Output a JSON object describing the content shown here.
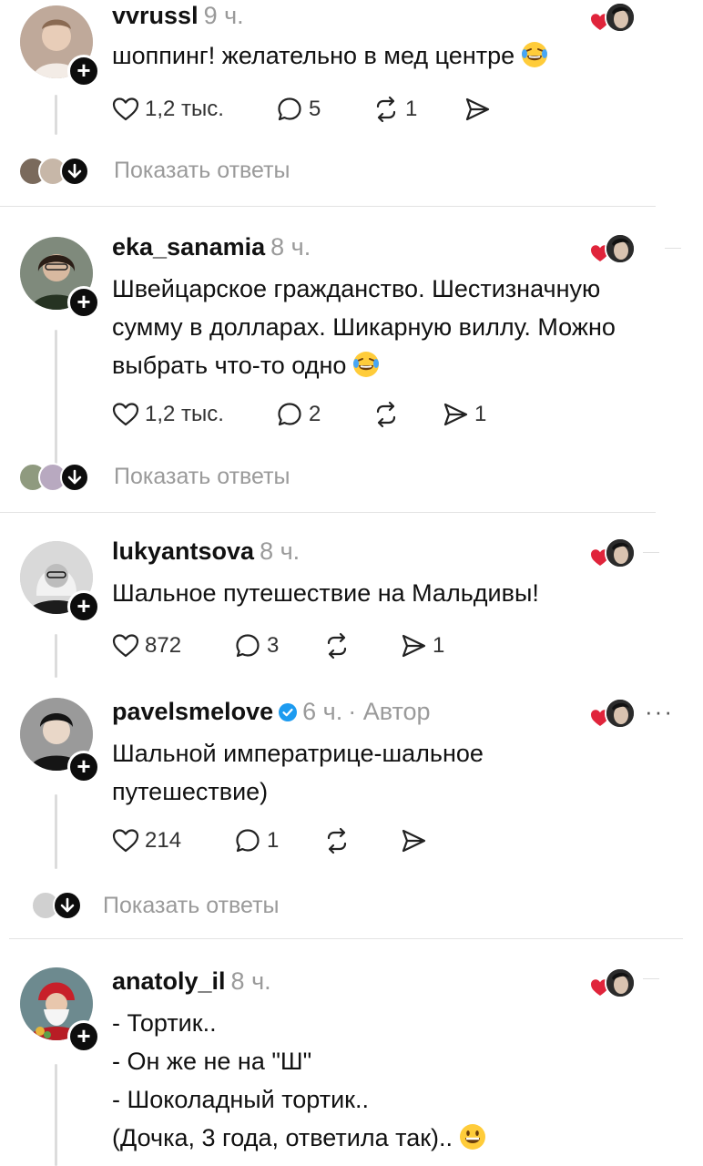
{
  "posts": [
    {
      "username": "vvrussl",
      "time": "9 ч.",
      "lines": [
        "шоппинг! желательно в мед центре"
      ],
      "emoji": "laughing-tears",
      "likes": "1,2 тыс.",
      "comments": "5",
      "reposts": "1",
      "shares": "",
      "show_replies": "Показать ответы"
    },
    {
      "username": "eka_sanamia",
      "time": "8 ч.",
      "lines": [
        "Швейцарское гражданство. Шестизначную",
        "сумму в долларах. Шикарную виллу. Можно",
        "выбрать что-то одно"
      ],
      "emoji": "laughing-tears",
      "likes": "1,2 тыс.",
      "comments": "2",
      "reposts": "",
      "shares": "1",
      "show_replies": "Показать ответы"
    },
    {
      "username": "lukyantsova",
      "time": "8 ч.",
      "lines": [
        "Шальное путешествие на Мальдивы!"
      ],
      "likes": "872",
      "comments": "3",
      "reposts": "",
      "shares": "1"
    },
    {
      "username": "pavelsmelove",
      "time": "6 ч.",
      "author_label": "· Автор",
      "verified": true,
      "lines": [
        "Шальной императрице-шальное",
        "путешествие)"
      ],
      "likes": "214",
      "comments": "1",
      "reposts": "",
      "shares": "",
      "more": "···",
      "show_replies": "Показать ответы"
    },
    {
      "username": "anatoly_il",
      "time": "8 ч.",
      "lines": [
        "- Тортик..",
        "- Он же не на \"Ш\"",
        "- Шоколадный тортик..",
        "(Дочка, 3 года, ответила так).."
      ],
      "emoji": "grinning"
    }
  ],
  "colors": {
    "heart_red": "#e0243b",
    "verified_blue": "#1d9bf0",
    "muted_text": "#9a9a9a"
  },
  "icons": {
    "like": "heart-outline-icon",
    "comment": "comment-bubble-icon",
    "repost": "repost-arrows-icon",
    "share": "send-arrow-icon",
    "follow": "plus-icon",
    "expand": "arrow-down-icon"
  }
}
